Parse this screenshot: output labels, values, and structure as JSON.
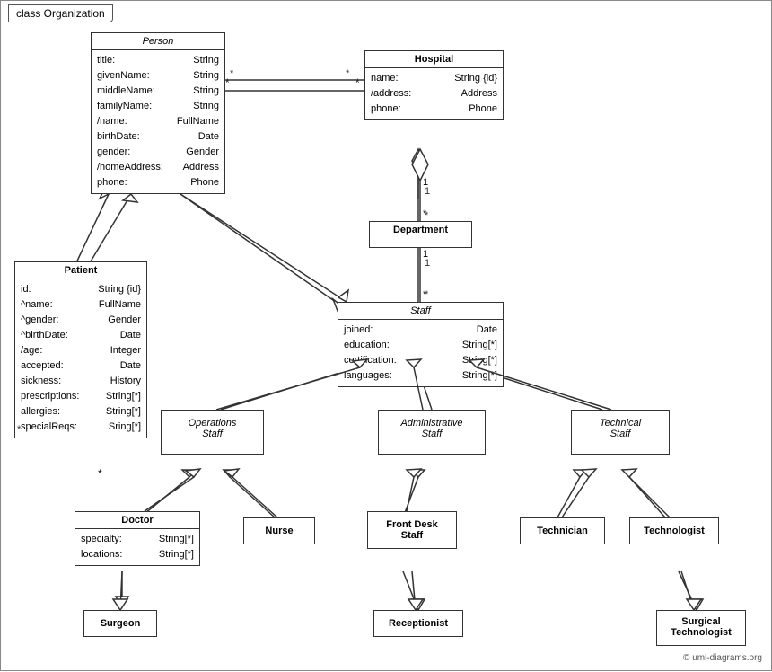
{
  "title": "class Organization",
  "copyright": "© uml-diagrams.org",
  "boxes": {
    "person": {
      "label": "Person",
      "italic": true,
      "attrs": [
        [
          "title:",
          "String"
        ],
        [
          "givenName:",
          "String"
        ],
        [
          "middleName:",
          "String"
        ],
        [
          "familyName:",
          "String"
        ],
        [
          "/name:",
          "FullName"
        ],
        [
          "birthDate:",
          "Date"
        ],
        [
          "gender:",
          "Gender"
        ],
        [
          "/homeAddress:",
          "Address"
        ],
        [
          "phone:",
          "Phone"
        ]
      ]
    },
    "hospital": {
      "label": "Hospital",
      "italic": false,
      "attrs": [
        [
          "name:",
          "String {id}"
        ],
        [
          "/address:",
          "Address"
        ],
        [
          "phone:",
          "Phone"
        ]
      ]
    },
    "department": {
      "label": "Department",
      "italic": false,
      "attrs": []
    },
    "staff": {
      "label": "Staff",
      "italic": true,
      "attrs": [
        [
          "joined:",
          "Date"
        ],
        [
          "education:",
          "String[*]"
        ],
        [
          "certification:",
          "String[*]"
        ],
        [
          "languages:",
          "String[*]"
        ]
      ]
    },
    "patient": {
      "label": "Patient",
      "italic": false,
      "attrs": [
        [
          "id:",
          "String {id}"
        ],
        [
          "^name:",
          "FullName"
        ],
        [
          "^gender:",
          "Gender"
        ],
        [
          "^birthDate:",
          "Date"
        ],
        [
          "/age:",
          "Integer"
        ],
        [
          "accepted:",
          "Date"
        ],
        [
          "sickness:",
          "History"
        ],
        [
          "prescriptions:",
          "String[*]"
        ],
        [
          "allergies:",
          "String[*]"
        ],
        [
          "specialReqs:",
          "Sring[*]"
        ]
      ]
    },
    "operations_staff": {
      "label": "Operations\nStaff",
      "italic": true,
      "attrs": []
    },
    "admin_staff": {
      "label": "Administrative\nStaff",
      "italic": true,
      "attrs": []
    },
    "technical_staff": {
      "label": "Technical\nStaff",
      "italic": true,
      "attrs": []
    },
    "doctor": {
      "label": "Doctor",
      "italic": false,
      "attrs": [
        [
          "specialty:",
          "String[*]"
        ],
        [
          "locations:",
          "String[*]"
        ]
      ]
    },
    "nurse": {
      "label": "Nurse",
      "italic": false,
      "attrs": []
    },
    "front_desk": {
      "label": "Front Desk\nStaff",
      "italic": false,
      "attrs": []
    },
    "technician": {
      "label": "Technician",
      "italic": false,
      "attrs": []
    },
    "technologist": {
      "label": "Technologist",
      "italic": false,
      "attrs": []
    },
    "surgeon": {
      "label": "Surgeon",
      "italic": false,
      "attrs": []
    },
    "receptionist": {
      "label": "Receptionist",
      "italic": false,
      "attrs": []
    },
    "surgical_tech": {
      "label": "Surgical\nTechnologist",
      "italic": false,
      "attrs": []
    }
  }
}
